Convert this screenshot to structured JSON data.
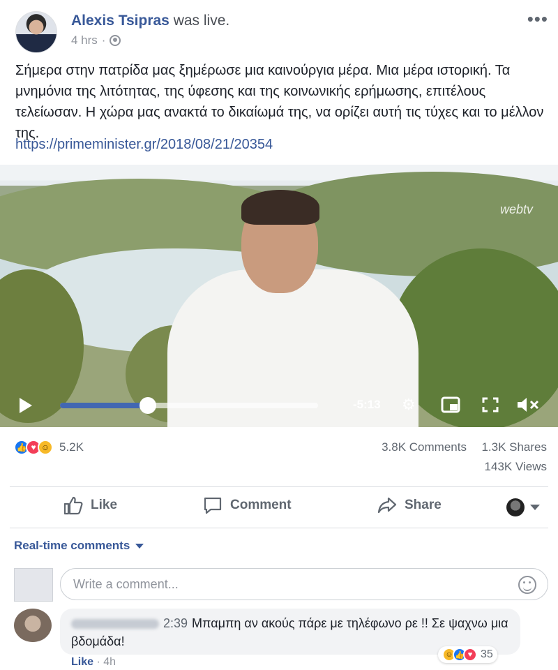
{
  "post": {
    "author": "Alexis Tsipras",
    "status": "was live.",
    "time": "4 hrs",
    "audience_icon": "globe-icon",
    "more_icon": "•••",
    "text": "Σήμερα στην πατρίδα μας ξημέρωσε μια καινούργια μέρα. Μια μέρα ιστορική. Τα μνημόνια της λιτότητας, της ύφεσης και της κοινωνικής ερήμωσης, επιτέλους τελείωσαν. Η χώρα μας ανακτά το δικαίωμά της, να ορίζει αυτή τις τύχες και το μέλλον της.",
    "link": "https://primeminister.gr/2018/08/21/20354"
  },
  "video": {
    "watermark": "webtv",
    "remaining_time": "-5:13",
    "progress": 0.34,
    "accent": "#4267b2"
  },
  "stats": {
    "reactions_count": "5.2K",
    "reaction_types": [
      "like",
      "love",
      "haha"
    ],
    "comments": "3.8K Comments",
    "shares": "1.3K Shares",
    "views": "143K Views"
  },
  "actions": {
    "like": "Like",
    "comment": "Comment",
    "share": "Share"
  },
  "comments": {
    "filter_label": "Real-time comments",
    "input_placeholder": "Write a comment...",
    "items": [
      {
        "timestamp": "2:39",
        "text": "Μπαμπη αν ακούς πάρε με τηλέφωνο ρε !! Σε ψαχνω μια βδομάδα!",
        "reaction_count": "35",
        "like_label": "Like",
        "age": "· 4h"
      }
    ]
  }
}
